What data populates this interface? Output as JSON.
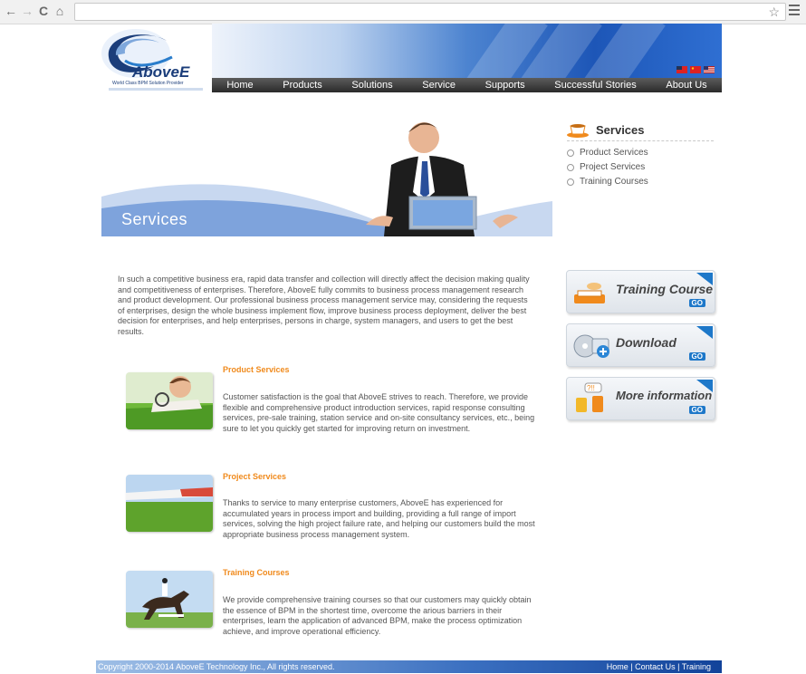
{
  "browser": {
    "back_icon": "←",
    "forward_icon": "→",
    "reload_icon": "C",
    "home_icon": "⌂",
    "star_icon": "☆"
  },
  "header": {
    "logo_text": "AboveE",
    "logo_tagline": "World Class BPM Solution Provider",
    "nav": [
      "Home",
      "Products",
      "Solutions",
      "Service",
      "Supports",
      "Successful Stories",
      "About Us"
    ]
  },
  "hero": {
    "title": "Services"
  },
  "sidebar": {
    "title": "Services",
    "items": [
      "Product Services",
      "Project Services",
      "Training Courses"
    ],
    "promos": [
      {
        "label": "Training Course",
        "go": "GO"
      },
      {
        "label": "Download",
        "go": "GO"
      },
      {
        "label": "More information",
        "go": "GO"
      }
    ]
  },
  "main": {
    "intro": "In such a competitive business era, rapid data transfer and collection will directly affect the decision making quality and competitiveness of enterprises. Therefore, AboveE fully commits to business process management research and product development. Our professional business process management service may, considering the requests of enterprises, design the whole business implement flow, improve business process deployment, deliver the best decision for enterprises, and help enterprises, persons in charge, system managers, and users to get the best results.",
    "services": [
      {
        "title": "Product Services",
        "text": "Customer satisfaction is the goal that AboveE strives to reach. Therefore, we provide flexible and comprehensive product introduction services, rapid response consulting services, pre-sale training, station service and on-site consultancy services, etc., being sure to let you quickly get started for improving return on investment."
      },
      {
        "title": "Project Services",
        "text": "Thanks to service to many enterprise customers, AboveE has experienced for accumulated years in process import and building, providing a full range of import services, solving the high project failure rate, and helping our customers build the most appropriate business process management system."
      },
      {
        "title": "Training Courses",
        "text": "We provide comprehensive training courses so that our customers may quickly obtain the essence of BPM in the shortest time, overcome the arious barriers in their enterprises, learn the application of advanced BPM, make the process optimization achieve, and improve operational efficiency."
      }
    ]
  },
  "footer": {
    "copyright": "Copyright 2000-2014 AboveE Technology Inc., All rights reserved.",
    "links": [
      "Home",
      "Contact Us",
      "Training"
    ],
    "separator": " | "
  }
}
